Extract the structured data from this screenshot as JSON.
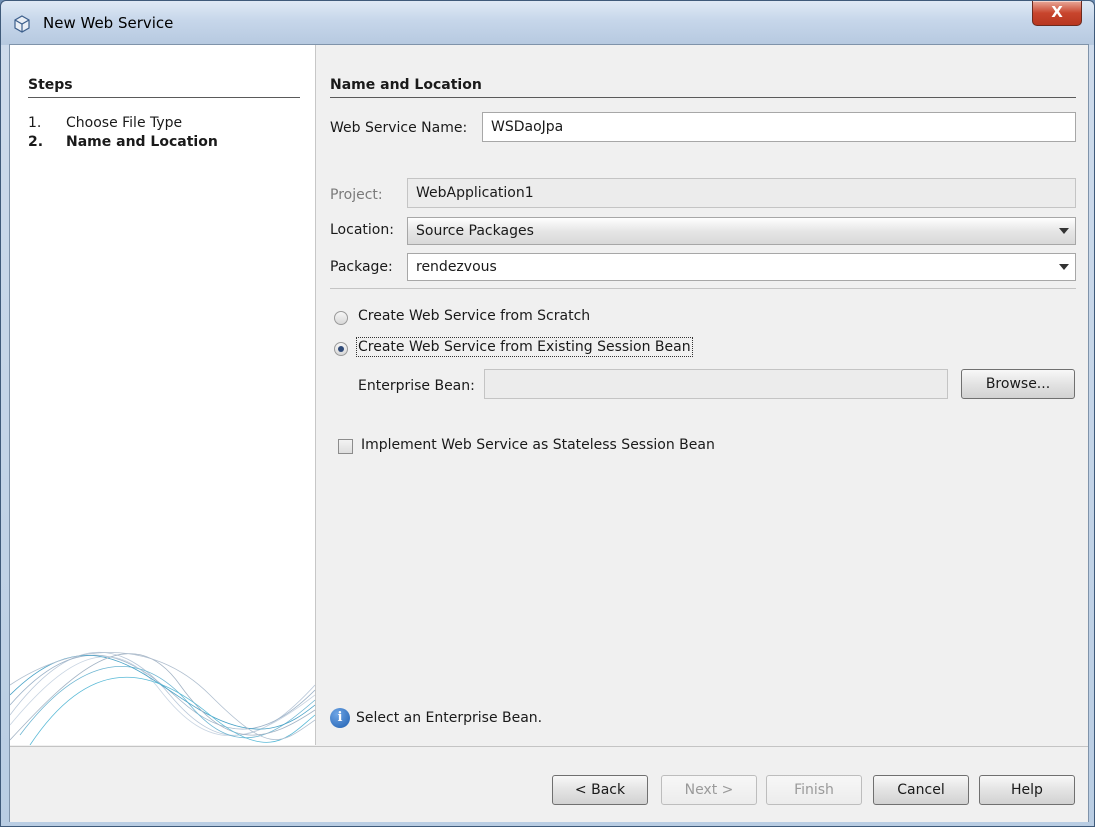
{
  "window": {
    "title": "New Web Service",
    "close_label": "X"
  },
  "steps": {
    "title": "Steps",
    "items": [
      {
        "num": "1.",
        "label": "Choose File Type"
      },
      {
        "num": "2.",
        "label": "Name and Location"
      }
    ]
  },
  "form": {
    "section_title": "Name and Location",
    "web_service_name_label": "Web Service Name:",
    "web_service_name_value": "WSDaoJpa",
    "project_label": "Project:",
    "project_value": "WebApplication1",
    "location_label": "Location:",
    "location_value": "Source Packages",
    "package_label": "Package:",
    "package_value": "rendezvous",
    "radio_scratch_label": "Create Web Service from Scratch",
    "radio_existing_label": "Create Web Service from Existing Session Bean",
    "enterprise_bean_label": "Enterprise Bean:",
    "enterprise_bean_value": "",
    "browse_label": "Browse...",
    "stateless_checkbox_label": "Implement Web Service as Stateless Session Bean",
    "status_message": "Select an Enterprise Bean."
  },
  "buttons": {
    "back": "< Back",
    "next": "Next >",
    "finish": "Finish",
    "cancel": "Cancel",
    "help": "Help"
  }
}
